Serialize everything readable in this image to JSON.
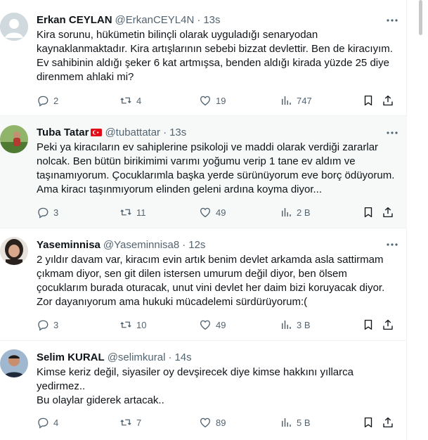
{
  "tweets": [
    {
      "name": "Erkan CEYLAN",
      "handle": "@ErkanCEYL4N",
      "time": "13s",
      "text": "Kira sorunu, hükümetin bilinçli olarak uyguladığı senaryodan kaynaklanmaktadır. Kira artışlarının sebebi bizzat devlettir. Ben de kiracıyım. Ev sahibinin aldığı şeker 6 kat artmışsa, benden aldığı kirada yüzde 25 diye direnmem ahlaki mi?",
      "replies": "2",
      "reposts": "4",
      "likes": "19",
      "views": "747"
    },
    {
      "name": "Tuba Tatar",
      "handle": "@tubattatar",
      "time": "13s",
      "text": "Peki ya kiracıların ev sahiplerine psikoloji ve maddi olarak verdiği zararlar nolcak. Ben bütün birikimimi varımı yoğumu verip 1 tane ev aldım ve taşınamıyorum. Çocuklarımla başka yerde sürünüyorum eve borç ödüyorum. Ama kiracı taşınmıyorum elinden geleni ardına koyma diyor...",
      "replies": "3",
      "reposts": "11",
      "likes": "49",
      "views": "2 B"
    },
    {
      "name": "Yaseminnisa",
      "handle": "@Yaseminnisa8",
      "time": "12s",
      "text": "2 yıldır davam var, kiracım evin artık benim devlet  arkamda asla sattirmam çıkmam diyor, sen git  dilen istersen umurum değil diyor, ben ölsem çocuklarım  burada oturacak, unut  vini  devlet her daim  bizi  koruyacak diyor.  Zor dayanıyorum ama hukuki  mücadelemi sürdürüyorum:(",
      "replies": "3",
      "reposts": "10",
      "likes": "49",
      "views": "3 B"
    },
    {
      "name": "Selim KURAL",
      "handle": "@selimkural",
      "time": "14s",
      "text": "Kimse keriz değil, siyasiler oy devşirecek diye kimse hakkını yıllarca yedirmez..\nBu olaylar giderek artacak..",
      "replies": "4",
      "reposts": "7",
      "likes": "89",
      "views": "5 B"
    }
  ],
  "icons": {
    "reply": "reply-icon",
    "repost": "repost-icon",
    "like": "heart-icon",
    "views": "views-icon",
    "bookmark": "bookmark-icon",
    "share": "share-icon",
    "more": "more-icon"
  },
  "colors": {
    "text": "#0f1419",
    "secondary": "#536471",
    "border": "#eff3f4",
    "flag_red": "#e30a17"
  }
}
